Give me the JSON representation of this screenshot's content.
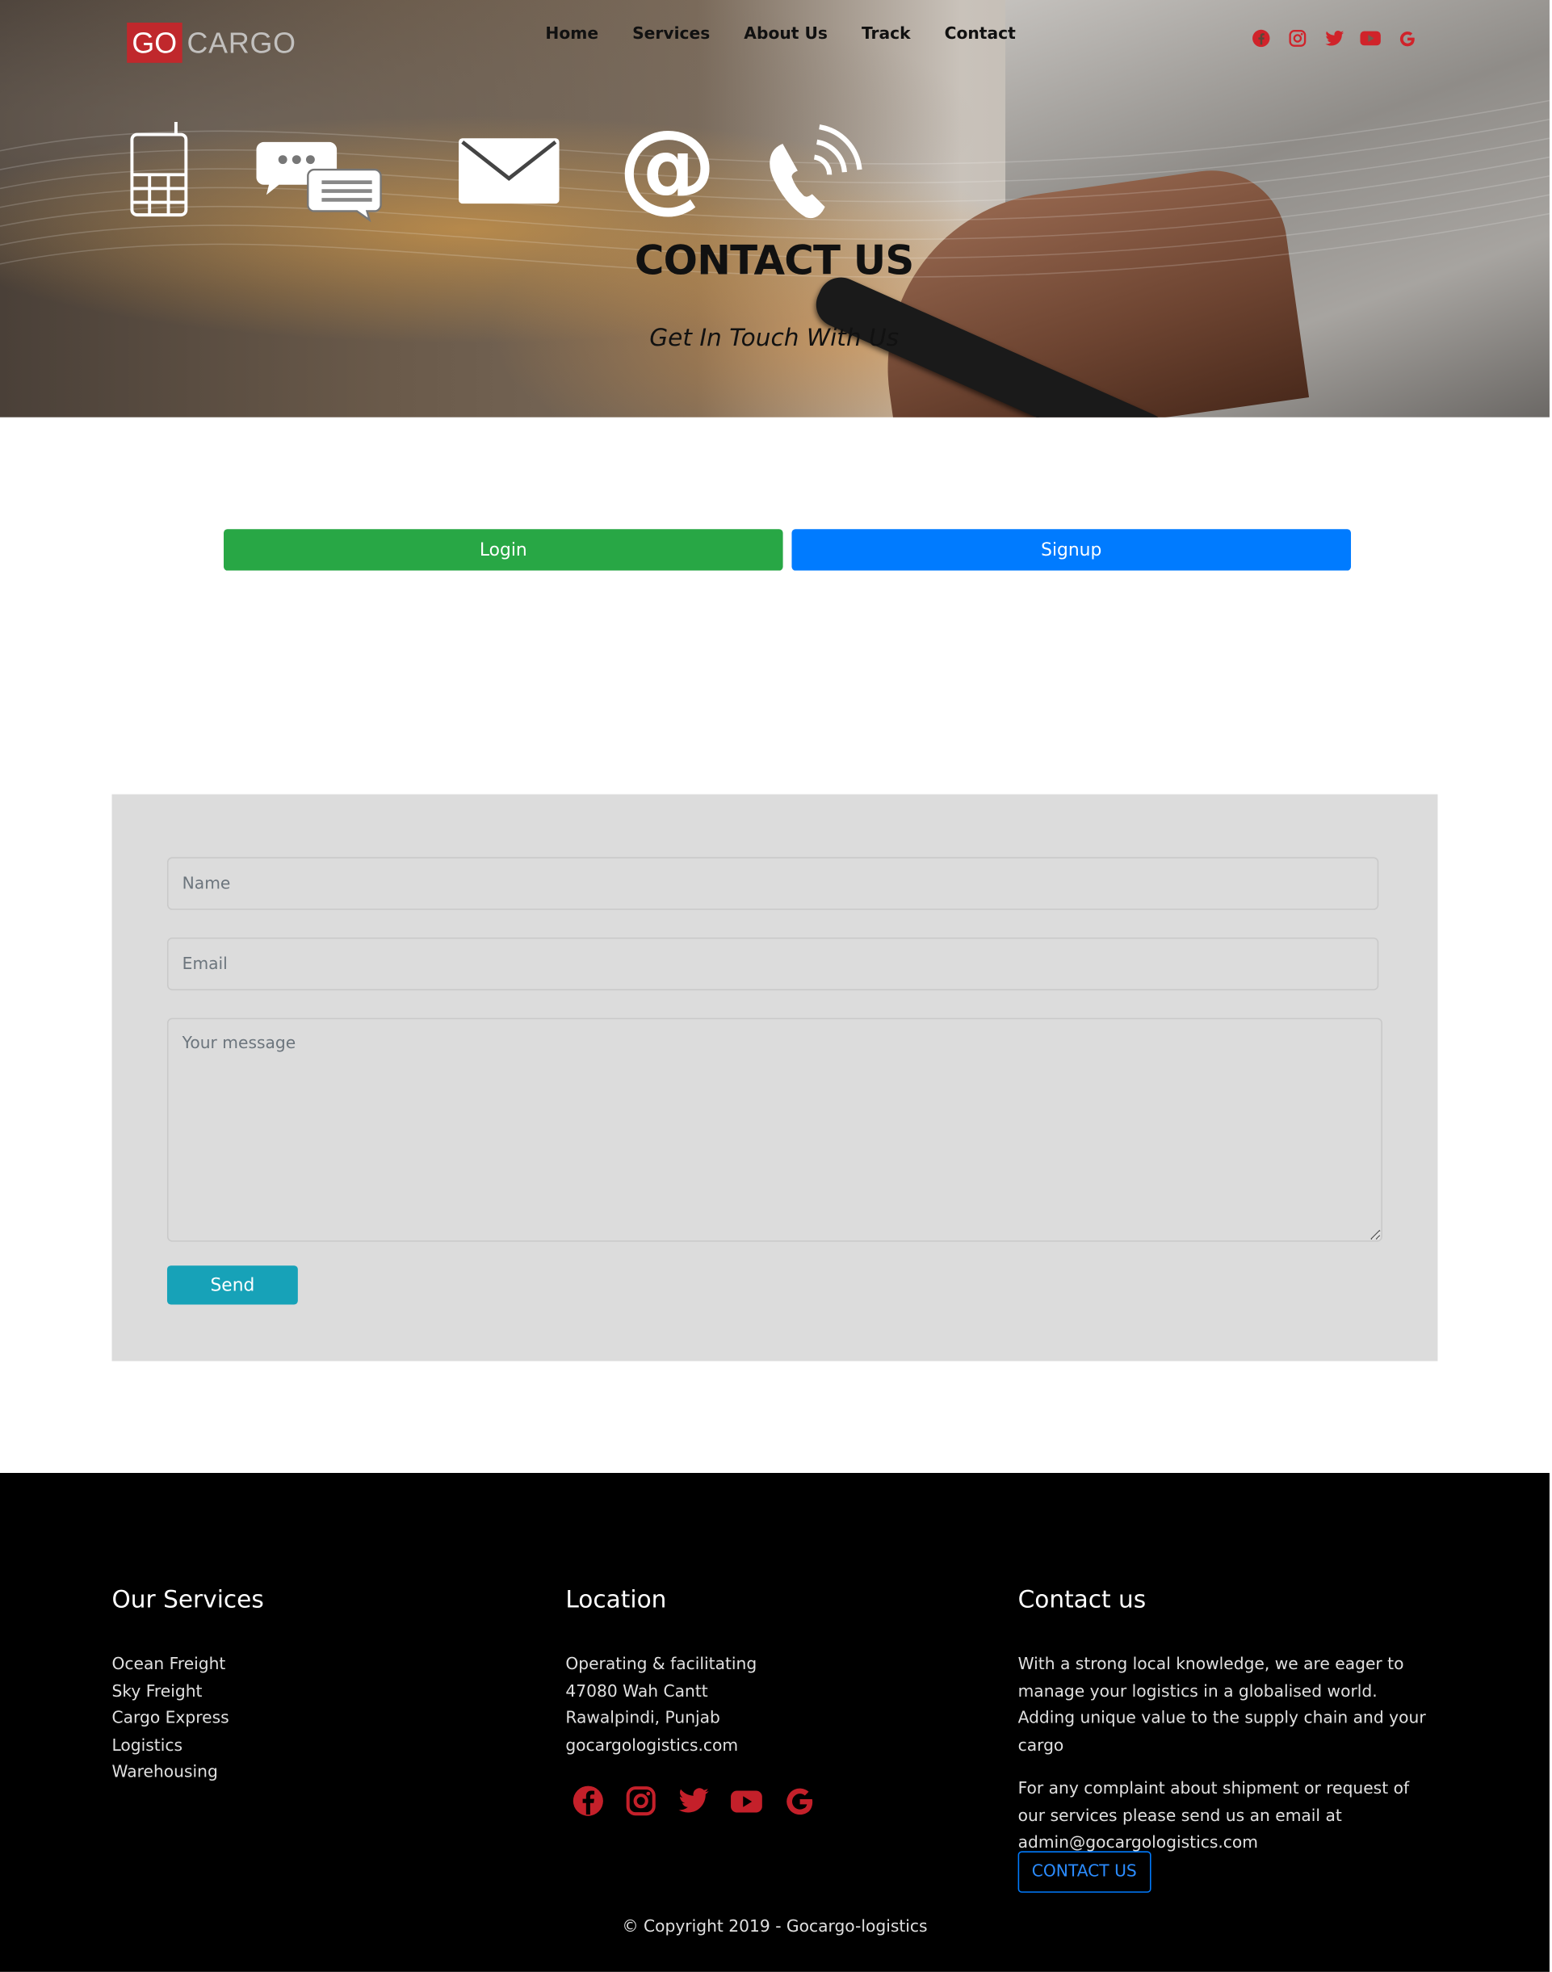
{
  "brand": {
    "logo_go": "GO",
    "logo_cargo": "CARGO"
  },
  "nav": {
    "items": [
      "Home",
      "Services",
      "About Us",
      "Track",
      "Contact"
    ]
  },
  "social_icons": [
    "facebook-icon",
    "instagram-icon",
    "twitter-icon",
    "youtube-icon",
    "google-icon"
  ],
  "colors": {
    "brand_red": "#c0282c",
    "login_green": "#28a745",
    "signup_blue": "#007bff",
    "send_teal": "#17a2b8",
    "form_bg": "#dcdcdc",
    "footer_bg": "#000000"
  },
  "hero": {
    "title": "CONTACT US",
    "subtitle": "Get In Touch With Us",
    "icons": [
      "mobile-phone-icon",
      "chat-bubbles-icon",
      "envelope-icon",
      "at-sign-icon",
      "phone-ringing-icon"
    ]
  },
  "auth": {
    "login_label": "Login",
    "signup_label": "Signup"
  },
  "form": {
    "name_placeholder": "Name",
    "email_placeholder": "Email",
    "message_placeholder": "Your message",
    "send_label": "Send"
  },
  "footer": {
    "services": {
      "title": "Our Services",
      "items": [
        "Ocean Freight",
        "Sky Freight",
        "Cargo Express",
        "Logistics",
        "Warehousing"
      ]
    },
    "location": {
      "title": "Location",
      "lines": [
        "Operating & facilitating",
        "47080 Wah Cantt",
        "Rawalpindi, Punjab",
        "gocargologistics.com"
      ]
    },
    "contact": {
      "title": "Contact us",
      "para1": "With a strong local knowledge, we are eager to manage your logistics in a globalised world. Adding unique value to the supply chain and your cargo",
      "para2": "For any complaint about shipment or request of our services please send us an email at admin@gocargologistics.com",
      "button_label": "CONTACT US"
    },
    "copyright": "© Copyright 2019 - Gocargo-logistics"
  }
}
